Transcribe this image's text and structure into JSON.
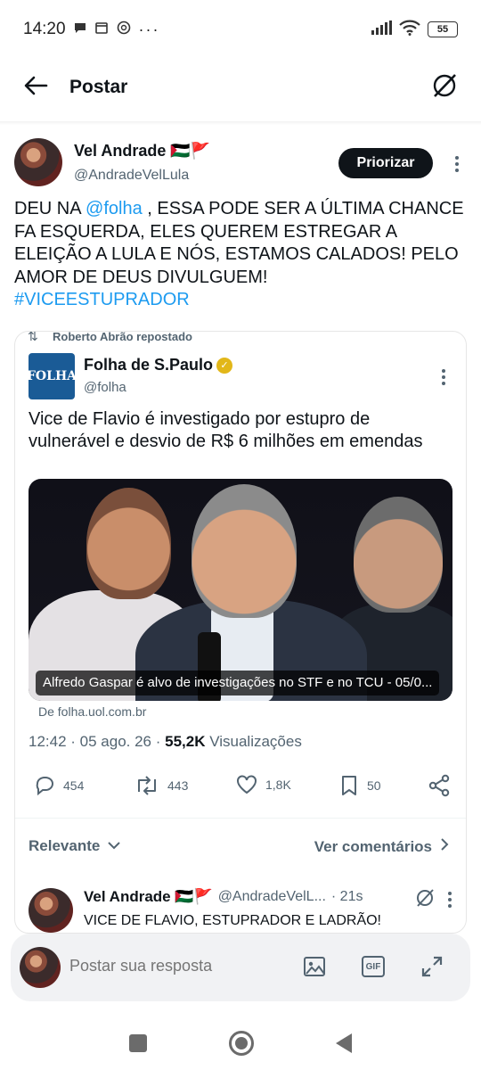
{
  "status_bar": {
    "time": "14:20",
    "battery": "55"
  },
  "header": {
    "title": "Postar"
  },
  "tweet": {
    "author_name": "Vel Andrade 🇵🇸🚩",
    "author_handle": "@AndradeVelLula",
    "priorizar_label": "Priorizar",
    "text_part1": "DEU NA ",
    "mention": "@folha",
    "text_part2": " , ESSA PODE SER A ÚLTIMA CHANCE FA ESQUERDA, ELES QUEREM ESTREGAR A ELEIÇÃO A LULA E NÓS, ESTAMOS CALADOS! PELO AMOR DE DEUS DIVULGUEM!",
    "hashtag": "#VICEESTUPRADOR"
  },
  "quote": {
    "repost_label": "Roberto Abrão repostado",
    "logo_text": "FOLHA",
    "name": "Folha de S.Paulo",
    "handle": "@folha",
    "text": "Vice de Flavio é investigado por estupro de vulnerável e desvio de R$ 6 milhões em emendas",
    "image_caption": "Alfredo Gaspar é alvo de investigações no STF e no TCU - 05/0...",
    "source": "De folha.uol.com.br",
    "time": "12:42 · 05 ago. 26 · ",
    "views_count": "55,2K",
    "views_label": " Visualizações"
  },
  "actions": {
    "replies": "454",
    "reposts": "443",
    "likes": "1,8K",
    "bookmarks": "50"
  },
  "filters": {
    "sort_label": "Relevante",
    "comments_label": "Ver comentários"
  },
  "reply": {
    "name": "Vel Andrade 🇵🇸🚩",
    "handle": "@AndradeVelL...",
    "time": "· 21s",
    "text": "VICE DE FLAVIO, ESTUPRADOR E LADRÃO!"
  },
  "composer": {
    "placeholder": "Postar sua resposta",
    "gif_label": "GIF"
  }
}
